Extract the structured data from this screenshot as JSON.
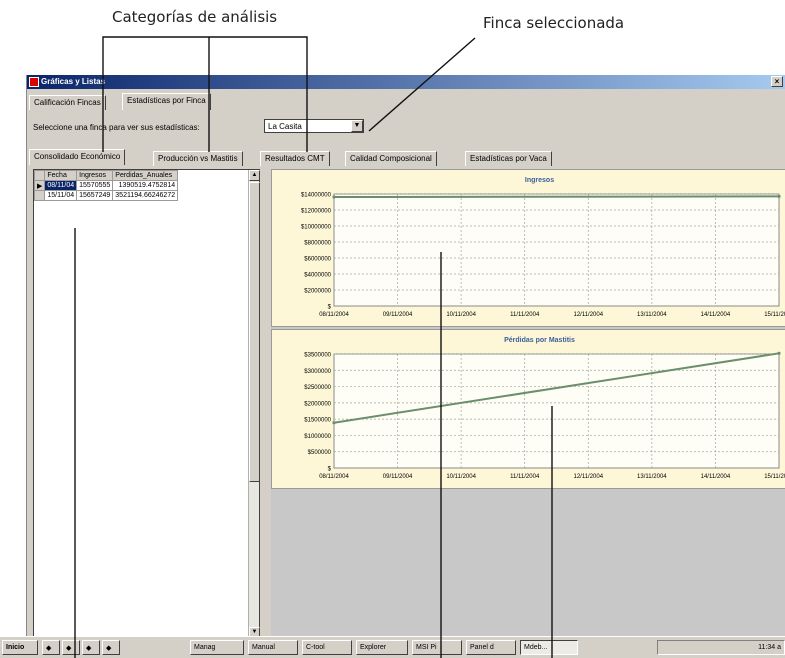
{
  "annotations": {
    "categories": "Categorías de análisis",
    "farm": "Finca seleccionada"
  },
  "window": {
    "title": "Gráficas y Listas"
  },
  "top_tabs": [
    "Calificación Fincas",
    "Estadísticas por Finca"
  ],
  "farm_selector": {
    "label": "Seleccione una finca para ver sus estadísticas:",
    "value": "La Casita"
  },
  "category_tabs": [
    "Consolidado Económico",
    "Producción vs Mastitis",
    "Resultados CMT",
    "Calidad Composicional",
    "Estadísticas por Vaca"
  ],
  "table": {
    "columns": [
      "Fecha",
      "Ingresos",
      "Perdidas_Anuales"
    ],
    "rows": [
      [
        "08/11/04",
        "15570555",
        "1390519.4752814"
      ],
      [
        "15/11/04",
        "15657249",
        "3521194.66246272"
      ]
    ]
  },
  "chart_data": [
    {
      "type": "line",
      "title": "Ingresos",
      "categories": [
        "08/11/2004",
        "09/11/2004",
        "10/11/2004",
        "11/11/2004",
        "12/11/2004",
        "13/11/2004",
        "14/11/2004",
        "15/11/2004"
      ],
      "y_ticks": [
        "$14000000",
        "$12000000",
        "$10000000",
        "$8000000",
        "$6000000",
        "$4000000",
        "$2000000",
        "$"
      ],
      "ylim": [
        0,
        16000000
      ],
      "series": [
        {
          "values": [
            15570555,
            15657249
          ],
          "x_index": [
            0,
            7
          ],
          "color": "#6b8e6b"
        }
      ],
      "grid": true
    },
    {
      "type": "line",
      "title": "Pérdidas por Mastitis",
      "categories": [
        "08/11/2004",
        "09/11/2004",
        "10/11/2004",
        "11/11/2004",
        "12/11/2004",
        "13/11/2004",
        "14/11/2004",
        "15/11/2004"
      ],
      "y_ticks": [
        "$3500000",
        "$3000000",
        "$2500000",
        "$2000000",
        "$1500000",
        "$1000000",
        "$500000",
        "$"
      ],
      "ylim": [
        0,
        3500000
      ],
      "series": [
        {
          "values": [
            1390519.48,
            3521194.66
          ],
          "x_index": [
            0,
            7
          ],
          "color": "#6b8e6b"
        }
      ],
      "grid": true
    }
  ],
  "taskbar": {
    "start": "Inicio",
    "items": [
      "Manag",
      "Manual",
      "C-tool",
      "Explorer",
      "MSI Pi",
      "Panel d",
      "Mdeb..."
    ],
    "clock": "11:34 a"
  }
}
